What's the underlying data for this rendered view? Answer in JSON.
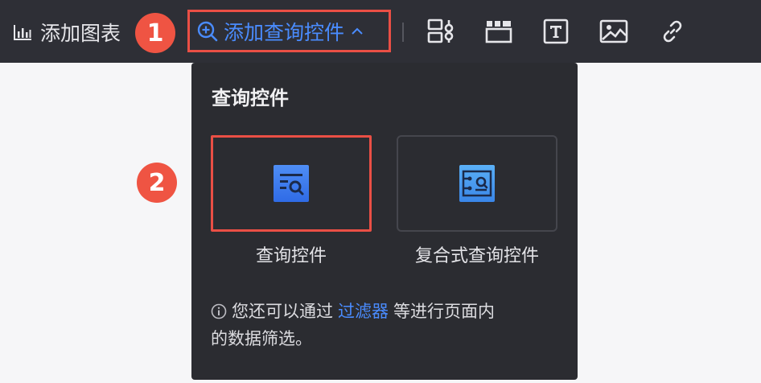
{
  "toolbar": {
    "add_chart_label": "添加图表",
    "add_query_label": "添加查询控件"
  },
  "badges": {
    "step1": "1",
    "step2": "2"
  },
  "popover": {
    "title": "查询控件",
    "cards": [
      {
        "label": "查询控件"
      },
      {
        "label": "复合式查询控件"
      }
    ],
    "hint": {
      "prefix": "您还可以通过",
      "link": "过滤器",
      "suffix_line1": "等进行页面内",
      "line2": "的数据筛选。"
    }
  },
  "colors": {
    "toolbar_bg": "#2e2f36",
    "accent_blue": "#4a8cff",
    "highlight_red": "#ea4f45",
    "popover_bg": "#2b2c31"
  }
}
